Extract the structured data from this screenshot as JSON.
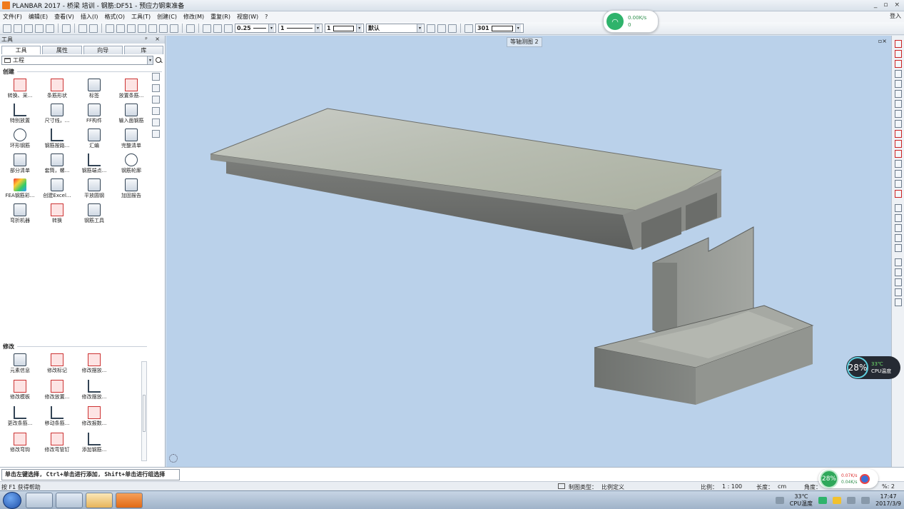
{
  "window": {
    "title": "PLANBAR 2017 - 桥梁 培训 - 钢筋:DF51 - 预应力钢束准备",
    "minimize": "_",
    "restore": "▫",
    "close": "×"
  },
  "menu": {
    "items": [
      "文件(F)",
      "编辑(E)",
      "查看(V)",
      "插入(I)",
      "格式(O)",
      "工具(T)",
      "创建(C)",
      "修改(M)",
      "重复(R)",
      "视窗(W)",
      "?"
    ],
    "login": "登入"
  },
  "toolbar": {
    "pen_thickness": "0.25",
    "line_type": "1",
    "hatch": "1",
    "layer": "默认",
    "style_number": "301"
  },
  "network_widget": {
    "up_speed": "0.00K/s",
    "down_speed": "0"
  },
  "panel": {
    "header": "工具",
    "header_controls": "ᵖ ×",
    "tabs": [
      "工具",
      "属性",
      "向导",
      "库"
    ],
    "project": "工程",
    "create_title": "创建",
    "create_tools": [
      "转换、采...",
      "条筋形状",
      "标签",
      "放置条筋...",
      "特别放置",
      "尺寸线，...",
      "FF构件",
      "输入面钢筋",
      "环形钢筋",
      "钢筋按路...",
      "汇编",
      "完整清单",
      "部分清单",
      "套筒，螺...",
      "钢筋端点...",
      "钢筋轮廓",
      "FEA钢筋彩...",
      "创建Excel...",
      "平放圆钢",
      "加固报告",
      "弯折机器",
      "转换",
      "钢筋工具"
    ],
    "modify_title": "修改",
    "modify_tools": [
      "元素信息",
      "修改标记",
      "修改摆放...",
      "修改模板",
      "修改放置...",
      "修改摆放...",
      "更改条筋...",
      "移动条筋...",
      "修改报数...",
      "修改弯钩",
      "修改弯管钉",
      "添加钢筋..."
    ]
  },
  "viewport": {
    "view_name": "等轴测图 2",
    "view_controls": "▫×"
  },
  "cpu_widget": {
    "usage": "28%",
    "temp": "33℃",
    "label": "CPU温度"
  },
  "status": {
    "command_prompt": "单击左键选择, Ctrl+单击进行添加, Shift+单击进行组选择",
    "help_hint": "按 F1 获得帮助",
    "draw_type_label": "制图类型：",
    "draw_type_value": "比例定义",
    "scale_label": "比例：",
    "scale_value": "1 : 100",
    "length_label": "长度：",
    "length_value": "cm",
    "angle_label": "角度：",
    "count_value": "%: 2"
  },
  "net_badge": {
    "percent": "28%",
    "up": "0.07K/s",
    "down": "0.04K/s"
  },
  "taskbar": {
    "temp": "33℃",
    "temp_label": "CPU温度",
    "time": "17:47",
    "date": "2017/3/9"
  },
  "colors": {
    "viewport_bg": "#bad1ea",
    "accent_orange": "#f07a1c",
    "wifi_green": "#2fb36b"
  }
}
